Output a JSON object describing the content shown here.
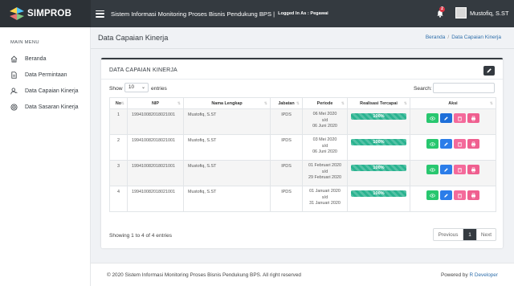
{
  "app": {
    "brand": "SIMPROB",
    "title": "Sistem Informasi Monitoring Proses Bisnis Pendukung BPS |",
    "logged_in": "Logged In As : Pegawai"
  },
  "topbar": {
    "notification_count": "2",
    "user_name": "Mustofiq, S.ST"
  },
  "sidebar": {
    "header": "MAIN MENU",
    "items": [
      {
        "label": "Beranda",
        "icon": "home-icon"
      },
      {
        "label": "Data Permintaan",
        "icon": "document-icon"
      },
      {
        "label": "Data Capaian Kinerja",
        "icon": "user-icon"
      },
      {
        "label": "Data Sasaran Kinerja",
        "icon": "target-icon"
      }
    ]
  },
  "page": {
    "title": "Data Capaian Kinerja",
    "breadcrumb": [
      "Beranda",
      "Data Capaian Kinerja"
    ],
    "breadcrumb_sep": "/"
  },
  "card": {
    "title": "DATA CAPAIAN KINERJA",
    "show_label": "Show",
    "show_value": "10",
    "entries_label": "entries",
    "search_label": "Search:",
    "columns": [
      "No",
      "NIP",
      "Nama Lengkap",
      "Jabatan",
      "Periode",
      "Realisasi Tercapai",
      "Aksi"
    ],
    "rows": [
      {
        "no": "1",
        "nip": "199410082018021001",
        "nama": "Mustofiq, S.ST",
        "jabatan": "IPDS",
        "periode_start": "06 Mei 2020",
        "periode_sd": "s/d",
        "periode_end": "06 Juni 2020",
        "realisasi": "100%",
        "realisasi_pct": 100
      },
      {
        "no": "2",
        "nip": "199410082018021001",
        "nama": "Mustofiq, S.ST",
        "jabatan": "IPDS",
        "periode_start": "03 Mei 2020",
        "periode_sd": "s/d",
        "periode_end": "06 Juni 2020",
        "realisasi": "100%",
        "realisasi_pct": 100
      },
      {
        "no": "3",
        "nip": "199410082018021001",
        "nama": "Mustofiq, S.ST",
        "jabatan": "IPDS",
        "periode_start": "01 Februari 2020",
        "periode_sd": "s/d",
        "periode_end": "29 Februari 2020",
        "realisasi": "100%",
        "realisasi_pct": 100
      },
      {
        "no": "4",
        "nip": "199410082018021001",
        "nama": "Mustofiq, S.ST",
        "jabatan": "IPDS",
        "periode_start": "01 Januari 2020",
        "periode_sd": "s/d",
        "periode_end": "31 Januari 2020",
        "realisasi": "100%",
        "realisasi_pct": 100
      }
    ],
    "showing": "Showing 1 to 4 of 4 entries",
    "pager": {
      "prev": "Previous",
      "current": "1",
      "next": "Next"
    }
  },
  "footer": {
    "copyright": "© 2020 Sistem Informasi Monitoring Proses Bisnis Pendukung BPS. All right reserved",
    "powered_by": "Powered by",
    "developer": "R Developer"
  },
  "colors": {
    "topbar": "#343a40",
    "accent": "#2ab390",
    "link": "#2f6fab"
  }
}
